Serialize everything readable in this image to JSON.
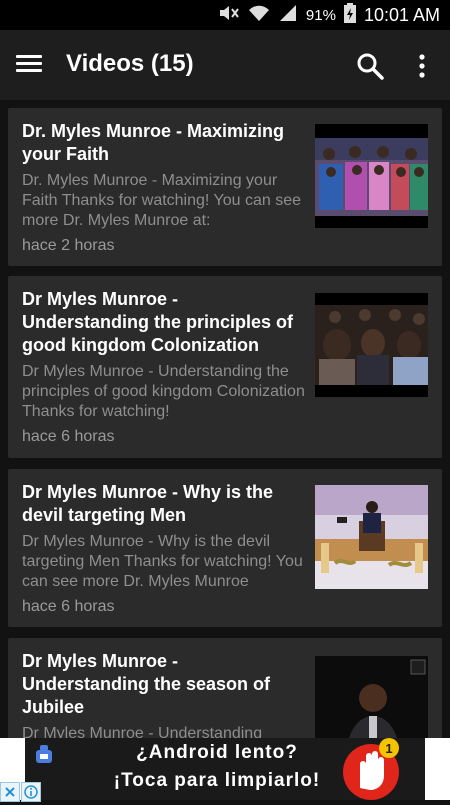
{
  "status_bar": {
    "battery": "91%",
    "time": "10:01 AM"
  },
  "app_bar": {
    "title": "Videos (15)"
  },
  "videos": [
    {
      "title": "Dr. Myles Munroe - Maximizing your Faith",
      "description": "Dr. Myles Munroe - Maximizing your Faith Thanks for watching! You can see more Dr. Myles Munroe at:",
      "time": "hace 2 horas"
    },
    {
      "title": "Dr  Myles Munroe - Understanding the principles of good kingdom Colonization",
      "description": "Dr Myles Munroe - Understanding the principles of good kingdom Colonization Thanks for watching!",
      "time": "hace 6 horas"
    },
    {
      "title": "Dr Myles Munroe - Why is the devil targeting Men",
      "description": "Dr Myles Munroe - Why is the devil targeting Men Thanks for watching! You can see more Dr. Myles Munroe",
      "time": "hace 6 horas"
    },
    {
      "title": "Dr  Myles Munroe  - Understanding the season of Jubilee",
      "description": "Dr Myles Munroe - Understanding",
      "time": ""
    }
  ],
  "ad": {
    "line1": "¿Android lento?",
    "line2": "¡Toca para limpiarlo!",
    "badge_count": "1"
  }
}
